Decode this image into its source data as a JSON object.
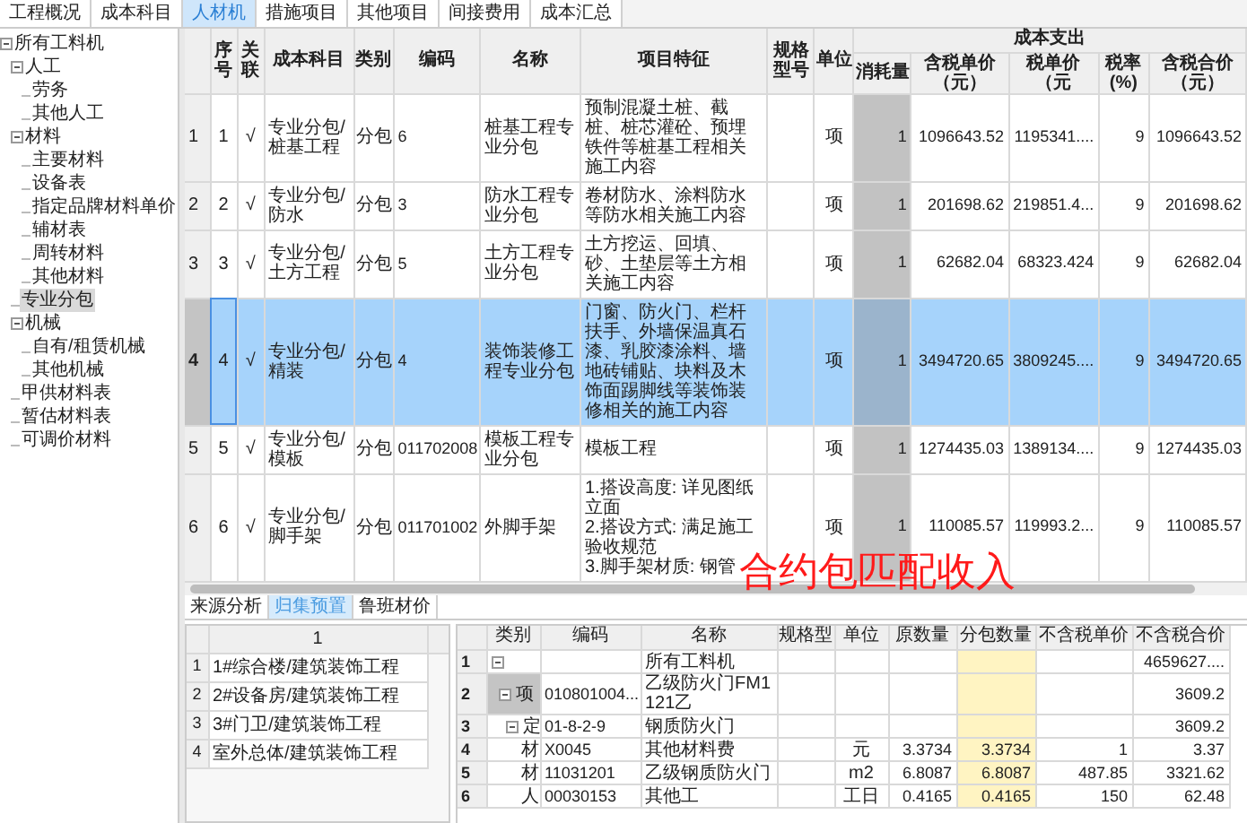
{
  "tabs": [
    {
      "label": "工程概况",
      "selected": false
    },
    {
      "label": "成本科目",
      "selected": false
    },
    {
      "label": "人材机",
      "selected": true
    },
    {
      "label": "措施项目",
      "selected": false
    },
    {
      "label": "其他项目",
      "selected": false
    },
    {
      "label": "间接费用",
      "selected": false
    },
    {
      "label": "成本汇总",
      "selected": false
    }
  ],
  "sidebar": {
    "tree": [
      {
        "label": "所有工料机",
        "expanded": true,
        "selected": false,
        "children": [
          {
            "label": "人工",
            "expanded": true,
            "selected": false,
            "children": [
              {
                "label": "劳务",
                "selected": false
              },
              {
                "label": "其他人工",
                "selected": false
              }
            ]
          },
          {
            "label": "材料",
            "expanded": true,
            "selected": false,
            "children": [
              {
                "label": "主要材料",
                "selected": false
              },
              {
                "label": "设备表",
                "selected": false
              },
              {
                "label": "指定品牌材料单价",
                "selected": false
              },
              {
                "label": "辅材表",
                "selected": false
              },
              {
                "label": "周转材料",
                "selected": false
              },
              {
                "label": "其他材料",
                "selected": false
              }
            ]
          },
          {
            "label": "专业分包",
            "selected": true
          },
          {
            "label": "机械",
            "expanded": true,
            "selected": false,
            "children": [
              {
                "label": "自有/租赁机械",
                "selected": false
              },
              {
                "label": "其他机械",
                "selected": false
              }
            ]
          },
          {
            "label": "甲供材料表",
            "selected": false
          },
          {
            "label": "暂估材料表",
            "selected": false
          },
          {
            "label": "可调价材料",
            "selected": false
          }
        ]
      }
    ]
  },
  "table": {
    "columns": [
      "序号",
      "关联",
      "成本科目",
      "类别",
      "编码",
      "名称",
      "项目特征",
      "规格型号",
      "单位"
    ],
    "group": {
      "title": "成本支出",
      "columns": [
        "消耗量",
        "含税单价（元）",
        "税单价（元",
        "税率(%)",
        "含税合价（元）"
      ]
    },
    "rows": [
      {
        "row_header": "1",
        "seq": "1",
        "linked": "√",
        "subject": "专业分包/桩基工程",
        "category": "分包",
        "code": "6",
        "name": "桩基工程专业分包",
        "feature": "预制混凝土桩、截桩、桩芯灌砼、预埋铁件等桩基工程相关施工内容",
        "unit": "项",
        "quantity": "1",
        "price_ex_tax": "1096643.52",
        "price_inc_tax": "1195341....",
        "tax_rate": "9",
        "total_ex_tax": "1096643.52",
        "selected": false
      },
      {
        "row_header": "2",
        "seq": "2",
        "linked": "√",
        "subject": "专业分包/防水",
        "category": "分包",
        "code": "3",
        "name": "防水工程专业分包",
        "feature": "卷材防水、涂料防水等防水相关施工内容",
        "unit": "项",
        "quantity": "1",
        "price_ex_tax": "201698.62",
        "price_inc_tax": "219851.4...",
        "tax_rate": "9",
        "total_ex_tax": "201698.62",
        "selected": false
      },
      {
        "row_header": "3",
        "seq": "3",
        "linked": "√",
        "subject": "专业分包/土方工程",
        "category": "分包",
        "code": "5",
        "name": "土方工程专业分包",
        "feature": "土方挖运、回填、砂、土垫层等土方相关施工内容",
        "unit": "项",
        "quantity": "1",
        "price_ex_tax": "62682.04",
        "price_inc_tax": "68323.424",
        "tax_rate": "9",
        "total_ex_tax": "62682.04",
        "selected": false
      },
      {
        "row_header": "4",
        "seq": "4",
        "linked": "√",
        "subject": "专业分包/精装",
        "category": "分包",
        "code": "4",
        "name": "装饰装修工程专业分包",
        "feature": "门窗、防火门、栏杆扶手、外墙保温真石漆、乳胶漆涂料、墙地砖铺贴、块料及木饰面踢脚线等装饰装修相关的施工内容",
        "unit": "项",
        "quantity": "1",
        "price_ex_tax": "3494720.65",
        "price_inc_tax": "3809245....",
        "tax_rate": "9",
        "total_ex_tax": "3494720.65",
        "selected": true
      },
      {
        "row_header": "5",
        "seq": "5",
        "linked": "√",
        "subject": "专业分包/模板",
        "category": "分包",
        "code": "011702008",
        "name": "模板工程专业分包",
        "feature": "模板工程",
        "unit": "项",
        "quantity": "1",
        "price_ex_tax": "1274435.03",
        "price_inc_tax": "1389134....",
        "tax_rate": "9",
        "total_ex_tax": "1274435.03",
        "selected": false
      },
      {
        "row_header": "6",
        "seq": "6",
        "linked": "√",
        "subject": "专业分包/脚手架",
        "category": "分包",
        "code": "011701002",
        "name": "外脚手架",
        "feature": "1.搭设高度: 详见图纸立面\n2.搭设方式: 满足施工验收规范\n3.脚手架材质: 钢管",
        "unit": "项",
        "quantity": "1",
        "price_ex_tax": "110085.57",
        "price_inc_tax": "119993.2...",
        "tax_rate": "9",
        "total_ex_tax": "110085.57",
        "selected": false
      }
    ]
  },
  "overlay_caption": "合约包匹配收入",
  "bottom_tabs": [
    {
      "label": "来源分析",
      "selected": false
    },
    {
      "label": "归集预置",
      "selected": true
    },
    {
      "label": "鲁班材价",
      "selected": false
    }
  ],
  "projects": {
    "column": "1",
    "rows": [
      {
        "row_number": "1",
        "name": "1#综合楼/建筑装饰工程"
      },
      {
        "row_number": "2",
        "name": "2#设备房/建筑装饰工程"
      },
      {
        "row_number": "3",
        "name": "3#门卫/建筑装饰工程"
      },
      {
        "row_number": "4",
        "name": "室外总体/建筑装饰工程"
      }
    ]
  },
  "resources": {
    "columns": [
      "类别",
      "编码",
      "名称",
      "规格型",
      "单位",
      "原数量",
      "分包数量",
      "不含税单价",
      "不含税合价"
    ],
    "rows": [
      {
        "row_number": "1",
        "name": "所有工料机",
        "total": "4659627....",
        "expanded": true,
        "children": [
          {
            "row_number": "2",
            "category": "项",
            "code": "010801004...",
            "name": "乙级防火门FM1121乙",
            "total": "3609.2",
            "expanded": true,
            "children": [
              {
                "row_number": "3",
                "category": "定",
                "code": "01-8-2-9",
                "name": "钢质防火门",
                "total": "3609.2",
                "expanded": true,
                "children": [
                  {
                    "row_number": "4",
                    "category": "材",
                    "code": "X0045",
                    "name": "其他材料费",
                    "unit": "元",
                    "qty": "3.3734",
                    "sub_qty": "3.3734",
                    "price": "1",
                    "total": "3.37"
                  },
                  {
                    "row_number": "5",
                    "category": "材",
                    "code": "11031201",
                    "name": "乙级钢质防火门",
                    "unit": "m2",
                    "qty": "6.8087",
                    "sub_qty": "6.8087",
                    "price": "487.85",
                    "total": "3321.62"
                  },
                  {
                    "row_number": "6",
                    "category": "人",
                    "code": "00030153",
                    "name": "其他工",
                    "unit": "工日",
                    "qty": "0.4165",
                    "sub_qty": "0.4165",
                    "price": "150",
                    "total": "62.48"
                  }
                ]
              }
            ]
          }
        ]
      }
    ]
  }
}
